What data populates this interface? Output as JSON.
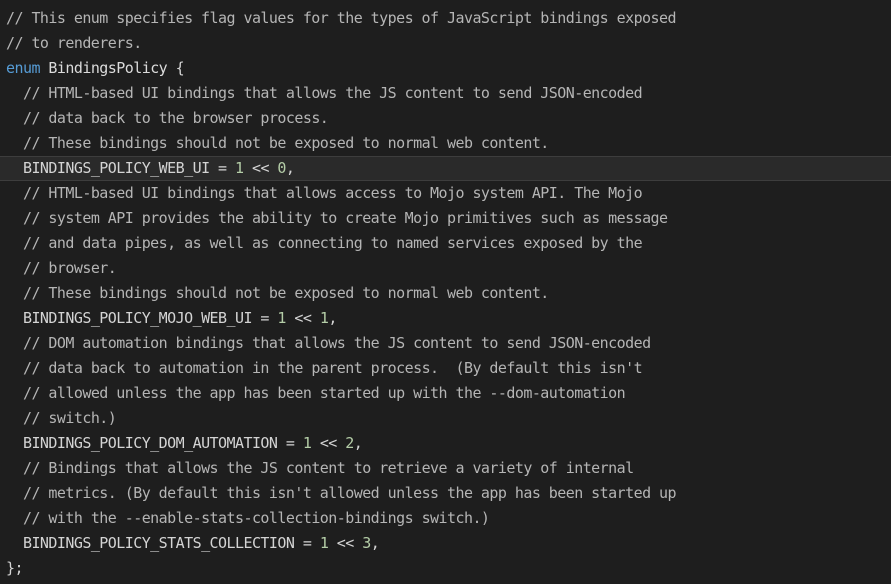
{
  "editor": {
    "theme": {
      "background": "#1e1e1e",
      "current_line_background": "#2a2a2a",
      "comment": "#b5b5b5",
      "keyword": "#569cd6",
      "identifier": "#dcdcdc",
      "constant": "#d4d4d4",
      "number": "#b5cea8",
      "punctuation": "#d4d4d4"
    },
    "lines": [
      {
        "current": false,
        "tokens": [
          {
            "type": "comment",
            "text": "// This enum specifies flag values for the types of JavaScript bindings exposed"
          }
        ]
      },
      {
        "current": false,
        "tokens": [
          {
            "type": "comment",
            "text": "// to renderers."
          }
        ]
      },
      {
        "current": false,
        "tokens": [
          {
            "type": "keyword",
            "text": "enum"
          },
          {
            "type": "punctuation",
            "text": " "
          },
          {
            "type": "identifier",
            "text": "BindingsPolicy"
          },
          {
            "type": "punctuation",
            "text": " {"
          }
        ]
      },
      {
        "current": false,
        "tokens": [
          {
            "type": "punctuation",
            "text": "  "
          },
          {
            "type": "comment",
            "text": "// HTML-based UI bindings that allows the JS content to send JSON-encoded"
          }
        ]
      },
      {
        "current": false,
        "tokens": [
          {
            "type": "punctuation",
            "text": "  "
          },
          {
            "type": "comment",
            "text": "// data back to the browser process."
          }
        ]
      },
      {
        "current": false,
        "tokens": [
          {
            "type": "punctuation",
            "text": "  "
          },
          {
            "type": "comment",
            "text": "// These bindings should not be exposed to normal web content."
          }
        ]
      },
      {
        "current": true,
        "tokens": [
          {
            "type": "punctuation",
            "text": "  "
          },
          {
            "type": "constant",
            "text": "BINDINGS_POLICY_WEB_UI"
          },
          {
            "type": "punctuation",
            "text": " = "
          },
          {
            "type": "number",
            "text": "1"
          },
          {
            "type": "punctuation",
            "text": " << "
          },
          {
            "type": "number",
            "text": "0"
          },
          {
            "type": "punctuation",
            "text": ","
          }
        ]
      },
      {
        "current": false,
        "tokens": [
          {
            "type": "punctuation",
            "text": "  "
          },
          {
            "type": "comment",
            "text": "// HTML-based UI bindings that allows access to Mojo system API. The Mojo"
          }
        ]
      },
      {
        "current": false,
        "tokens": [
          {
            "type": "punctuation",
            "text": "  "
          },
          {
            "type": "comment",
            "text": "// system API provides the ability to create Mojo primitives such as message"
          }
        ]
      },
      {
        "current": false,
        "tokens": [
          {
            "type": "punctuation",
            "text": "  "
          },
          {
            "type": "comment",
            "text": "// and data pipes, as well as connecting to named services exposed by the"
          }
        ]
      },
      {
        "current": false,
        "tokens": [
          {
            "type": "punctuation",
            "text": "  "
          },
          {
            "type": "comment",
            "text": "// browser."
          }
        ]
      },
      {
        "current": false,
        "tokens": [
          {
            "type": "punctuation",
            "text": "  "
          },
          {
            "type": "comment",
            "text": "// These bindings should not be exposed to normal web content."
          }
        ]
      },
      {
        "current": false,
        "tokens": [
          {
            "type": "punctuation",
            "text": "  "
          },
          {
            "type": "constant",
            "text": "BINDINGS_POLICY_MOJO_WEB_UI"
          },
          {
            "type": "punctuation",
            "text": " = "
          },
          {
            "type": "number",
            "text": "1"
          },
          {
            "type": "punctuation",
            "text": " << "
          },
          {
            "type": "number",
            "text": "1"
          },
          {
            "type": "punctuation",
            "text": ","
          }
        ]
      },
      {
        "current": false,
        "tokens": [
          {
            "type": "punctuation",
            "text": "  "
          },
          {
            "type": "comment",
            "text": "// DOM automation bindings that allows the JS content to send JSON-encoded"
          }
        ]
      },
      {
        "current": false,
        "tokens": [
          {
            "type": "punctuation",
            "text": "  "
          },
          {
            "type": "comment",
            "text": "// data back to automation in the parent process.  (By default this isn't"
          }
        ]
      },
      {
        "current": false,
        "tokens": [
          {
            "type": "punctuation",
            "text": "  "
          },
          {
            "type": "comment",
            "text": "// allowed unless the app has been started up with the --dom-automation"
          }
        ]
      },
      {
        "current": false,
        "tokens": [
          {
            "type": "punctuation",
            "text": "  "
          },
          {
            "type": "comment",
            "text": "// switch.)"
          }
        ]
      },
      {
        "current": false,
        "tokens": [
          {
            "type": "punctuation",
            "text": "  "
          },
          {
            "type": "constant",
            "text": "BINDINGS_POLICY_DOM_AUTOMATION"
          },
          {
            "type": "punctuation",
            "text": " = "
          },
          {
            "type": "number",
            "text": "1"
          },
          {
            "type": "punctuation",
            "text": " << "
          },
          {
            "type": "number",
            "text": "2"
          },
          {
            "type": "punctuation",
            "text": ","
          }
        ]
      },
      {
        "current": false,
        "tokens": [
          {
            "type": "punctuation",
            "text": "  "
          },
          {
            "type": "comment",
            "text": "// Bindings that allows the JS content to retrieve a variety of internal"
          }
        ]
      },
      {
        "current": false,
        "tokens": [
          {
            "type": "punctuation",
            "text": "  "
          },
          {
            "type": "comment",
            "text": "// metrics. (By default this isn't allowed unless the app has been started up"
          }
        ]
      },
      {
        "current": false,
        "tokens": [
          {
            "type": "punctuation",
            "text": "  "
          },
          {
            "type": "comment",
            "text": "// with the --enable-stats-collection-bindings switch.)"
          }
        ]
      },
      {
        "current": false,
        "tokens": [
          {
            "type": "punctuation",
            "text": "  "
          },
          {
            "type": "constant",
            "text": "BINDINGS_POLICY_STATS_COLLECTION"
          },
          {
            "type": "punctuation",
            "text": " = "
          },
          {
            "type": "number",
            "text": "1"
          },
          {
            "type": "punctuation",
            "text": " << "
          },
          {
            "type": "number",
            "text": "3"
          },
          {
            "type": "punctuation",
            "text": ","
          }
        ]
      },
      {
        "current": false,
        "tokens": [
          {
            "type": "punctuation",
            "text": "};"
          }
        ]
      }
    ]
  }
}
